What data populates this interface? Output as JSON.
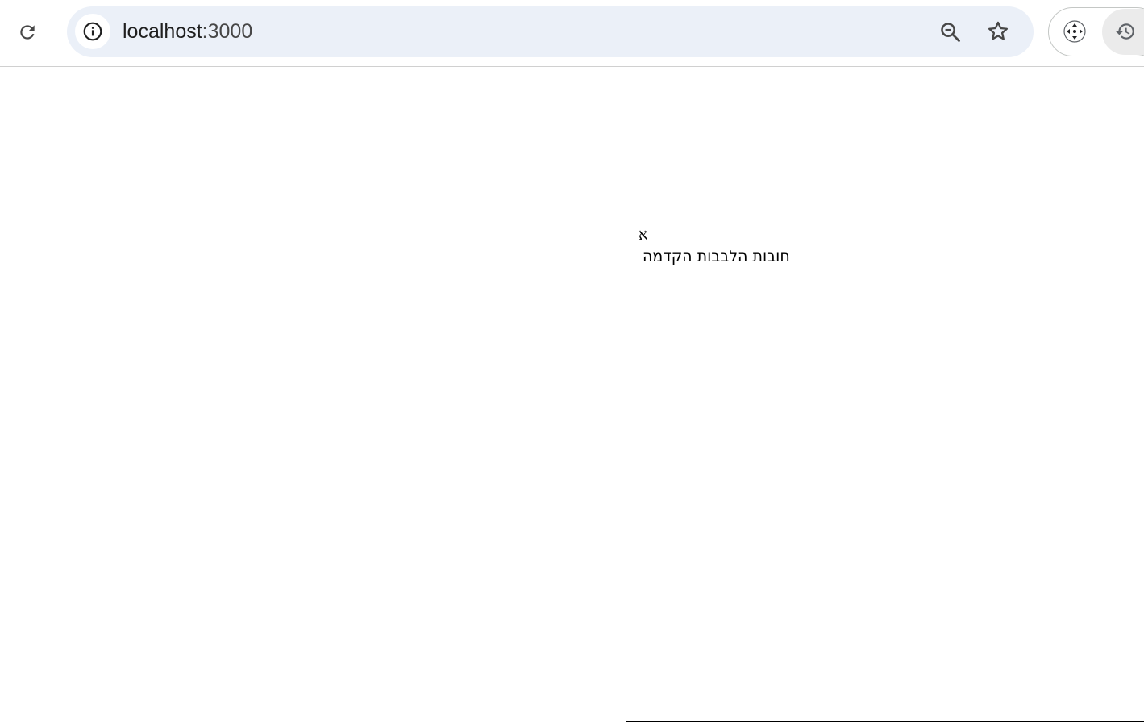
{
  "browser": {
    "url_host": "localhost",
    "url_port": ":3000",
    "icons": {
      "reload": "reload-icon",
      "site_info": "info-icon",
      "zoom": "zoom-out-icon",
      "bookmark": "star-icon",
      "extension_move": "move-icon",
      "extension_history": "history-icon"
    }
  },
  "page": {
    "letter": "א",
    "title": "חובות הלבבות הקדמה"
  }
}
